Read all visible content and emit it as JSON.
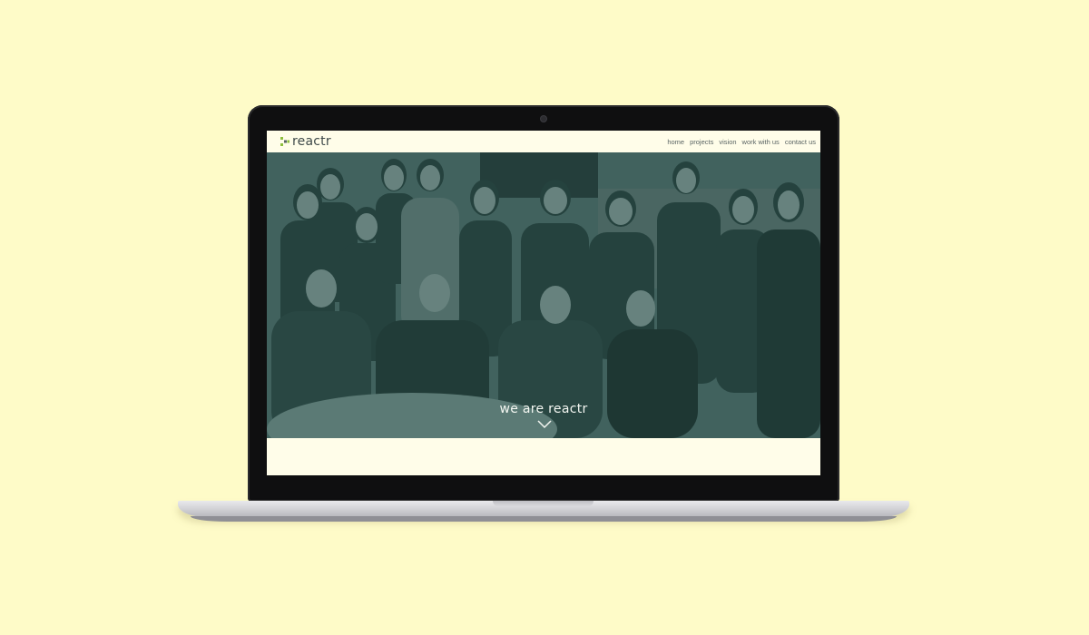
{
  "site": {
    "logo_text": "reactr",
    "logo_icon": "reactr-logo-mark",
    "nav": [
      "home",
      "projects",
      "vision",
      "work with us",
      "contact us"
    ]
  },
  "hero": {
    "title": "we are reactr",
    "scroll_icon": "chevron-down-icon",
    "image_description_icon": "team-photo"
  },
  "colors": {
    "page_background": "#fefbc8",
    "site_background": "#fffde9",
    "hero_tint": "#3d5e5a",
    "logo_accent": "#8dbf3d",
    "laptop_bezel": "#0f0f10"
  }
}
